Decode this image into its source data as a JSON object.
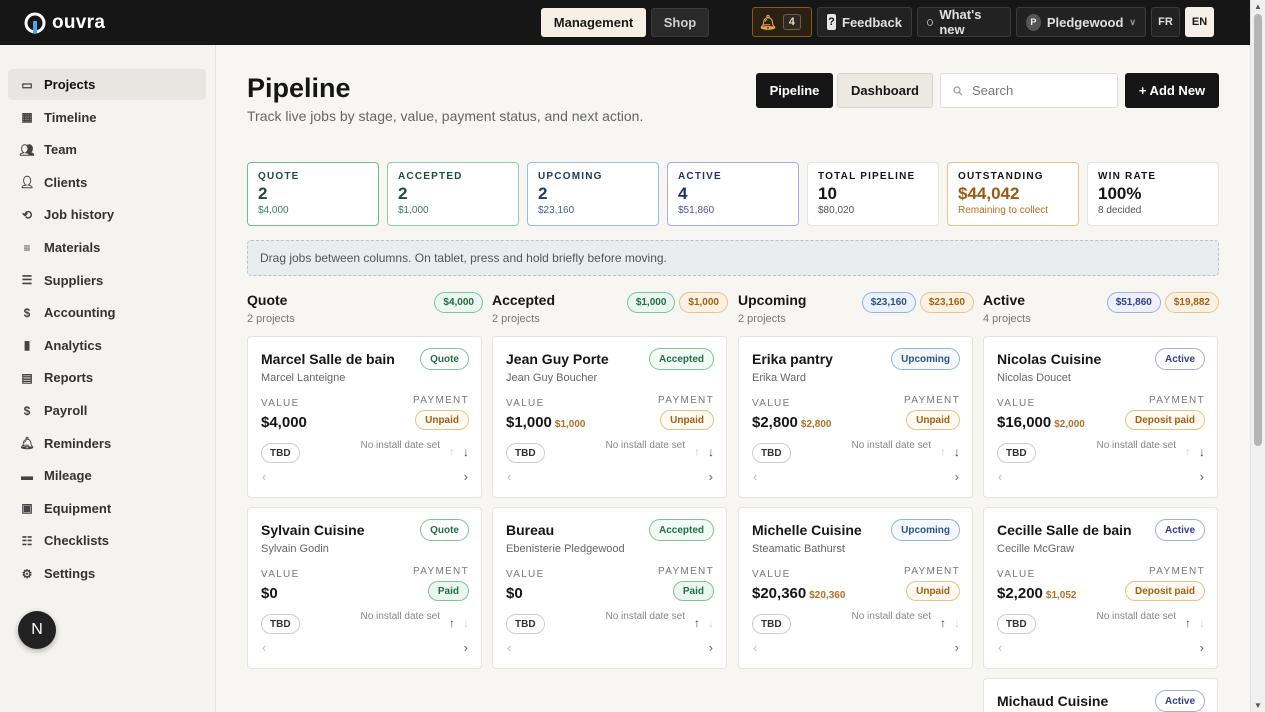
{
  "app": {
    "name": "ouvra"
  },
  "topnav": {
    "management": "Management",
    "shop": "Shop"
  },
  "topright": {
    "bell_count": "4",
    "feedback": "Feedback",
    "whats_new": "What's new",
    "org_initial": "P",
    "org": "Pledgewood",
    "lang_fr": "FR",
    "lang_en": "EN"
  },
  "sidebar": {
    "items": [
      {
        "label": "Projects",
        "icon": "folder-icon"
      },
      {
        "label": "Timeline",
        "icon": "calendar-icon"
      },
      {
        "label": "Team",
        "icon": "team-icon"
      },
      {
        "label": "Clients",
        "icon": "person-icon"
      },
      {
        "label": "Job history",
        "icon": "history-icon"
      },
      {
        "label": "Materials",
        "icon": "layers-icon"
      },
      {
        "label": "Suppliers",
        "icon": "list-icon"
      },
      {
        "label": "Accounting",
        "icon": "dollar-icon"
      },
      {
        "label": "Analytics",
        "icon": "bar-chart-icon"
      },
      {
        "label": "Reports",
        "icon": "document-icon"
      },
      {
        "label": "Payroll",
        "icon": "dollar-icon"
      },
      {
        "label": "Reminders",
        "icon": "bell-icon"
      },
      {
        "label": "Mileage",
        "icon": "car-icon"
      },
      {
        "label": "Equipment",
        "icon": "toolbox-icon"
      },
      {
        "label": "Checklists",
        "icon": "checklist-icon"
      },
      {
        "label": "Settings",
        "icon": "gear-icon"
      }
    ],
    "fab": "N"
  },
  "header": {
    "title": "Pipeline",
    "subtitle": "Track live jobs by stage, value, payment status, and next action.",
    "view_pipeline": "Pipeline",
    "view_dashboard": "Dashboard",
    "search_placeholder": "Search",
    "add_new": "+ Add New"
  },
  "stats": [
    {
      "label": "QUOTE",
      "value": "2",
      "sub": "$4,000"
    },
    {
      "label": "ACCEPTED",
      "value": "2",
      "sub": "$1,000"
    },
    {
      "label": "UPCOMING",
      "value": "2",
      "sub": "$23,160"
    },
    {
      "label": "ACTIVE",
      "value": "4",
      "sub": "$51,860"
    },
    {
      "label": "TOTAL PIPELINE",
      "value": "10",
      "sub": "$80,020"
    },
    {
      "label": "OUTSTANDING",
      "value": "$44,042",
      "sub": "Remaining to collect"
    },
    {
      "label": "WIN RATE",
      "value": "100%",
      "sub": "8 decided"
    }
  ],
  "hint": "Drag jobs between columns. On tablet, press and hold briefly before moving.",
  "columns": [
    {
      "title": "Quote",
      "sub": "2 projects",
      "badge1": "$4,000",
      "badge2": null
    },
    {
      "title": "Accepted",
      "sub": "2 projects",
      "badge1": "$1,000",
      "badge2": "$1,000"
    },
    {
      "title": "Upcoming",
      "sub": "2 projects",
      "badge1": "$23,160",
      "badge2": "$23,160"
    },
    {
      "title": "Active",
      "sub": "4 projects",
      "badge1": "$51,860",
      "badge2": "$19,882"
    }
  ],
  "card_labels": {
    "value": "VALUE",
    "payment": "PAYMENT",
    "tbd": "TBD",
    "no_date": "No install date set"
  },
  "cards": [
    {
      "name": "Marcel Salle de bain",
      "customer": "Marcel Lanteigne",
      "stage": "Quote",
      "value": "$4,000",
      "extra": "",
      "payment": "Unpaid"
    },
    {
      "name": "Sylvain Cuisine",
      "customer": "Sylvain Godin",
      "stage": "Quote",
      "value": "$0",
      "extra": "",
      "payment": "Paid"
    },
    {
      "name": "Jean Guy Porte",
      "customer": "Jean Guy Boucher",
      "stage": "Accepted",
      "value": "$1,000",
      "extra": "$1,000",
      "payment": "Unpaid"
    },
    {
      "name": "Bureau",
      "customer": "Ebenisterie Pledgewood",
      "stage": "Accepted",
      "value": "$0",
      "extra": "",
      "payment": "Paid"
    },
    {
      "name": "Erika pantry",
      "customer": "Erika Ward",
      "stage": "Upcoming",
      "value": "$2,800",
      "extra": "$2,800",
      "payment": "Unpaid"
    },
    {
      "name": "Michelle Cuisine",
      "customer": "Steamatic Bathurst",
      "stage": "Upcoming",
      "value": "$20,360",
      "extra": "$20,360",
      "payment": "Unpaid"
    },
    {
      "name": "Nicolas Cuisine",
      "customer": "Nicolas Doucet",
      "stage": "Active",
      "value": "$16,000",
      "extra": "$2,000",
      "payment": "Deposit paid"
    },
    {
      "name": "Cecille Salle de bain",
      "customer": "Cecille McGraw",
      "stage": "Active",
      "value": "$2,200",
      "extra": "$1,052",
      "payment": "Deposit paid"
    },
    {
      "name": "Michaud Cuisine",
      "customer": "",
      "stage": "Active",
      "value": "",
      "extra": "",
      "payment": ""
    }
  ]
}
